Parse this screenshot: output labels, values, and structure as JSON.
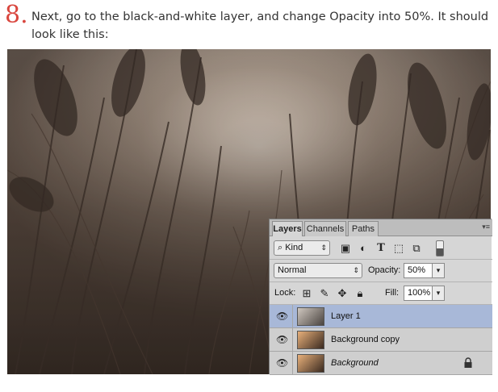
{
  "step": {
    "number": "8.",
    "text": "Next, go to the black-and-white layer, and change Opacity into 50%. It should look like this:"
  },
  "layers_panel": {
    "tabs": [
      "Layers",
      "Channels",
      "Paths"
    ],
    "active_tab": "Layers",
    "filter": {
      "kind_label": "Kind"
    },
    "blend_mode": "Normal",
    "opacity_label": "Opacity:",
    "opacity_value": "50%",
    "lock_label": "Lock:",
    "fill_label": "Fill:",
    "fill_value": "100%",
    "layers": [
      {
        "name": "Layer 1",
        "selected": true,
        "visible": true,
        "locked": false,
        "italic": false
      },
      {
        "name": "Background copy",
        "selected": false,
        "visible": true,
        "locked": false,
        "italic": false
      },
      {
        "name": "Background",
        "selected": false,
        "visible": true,
        "locked": true,
        "italic": true
      }
    ]
  },
  "colors": {
    "step_number": "#d9463e",
    "body_text": "#333333",
    "selected_layer": "#a8b8d8",
    "panel_bg": "#d6d6d6"
  }
}
